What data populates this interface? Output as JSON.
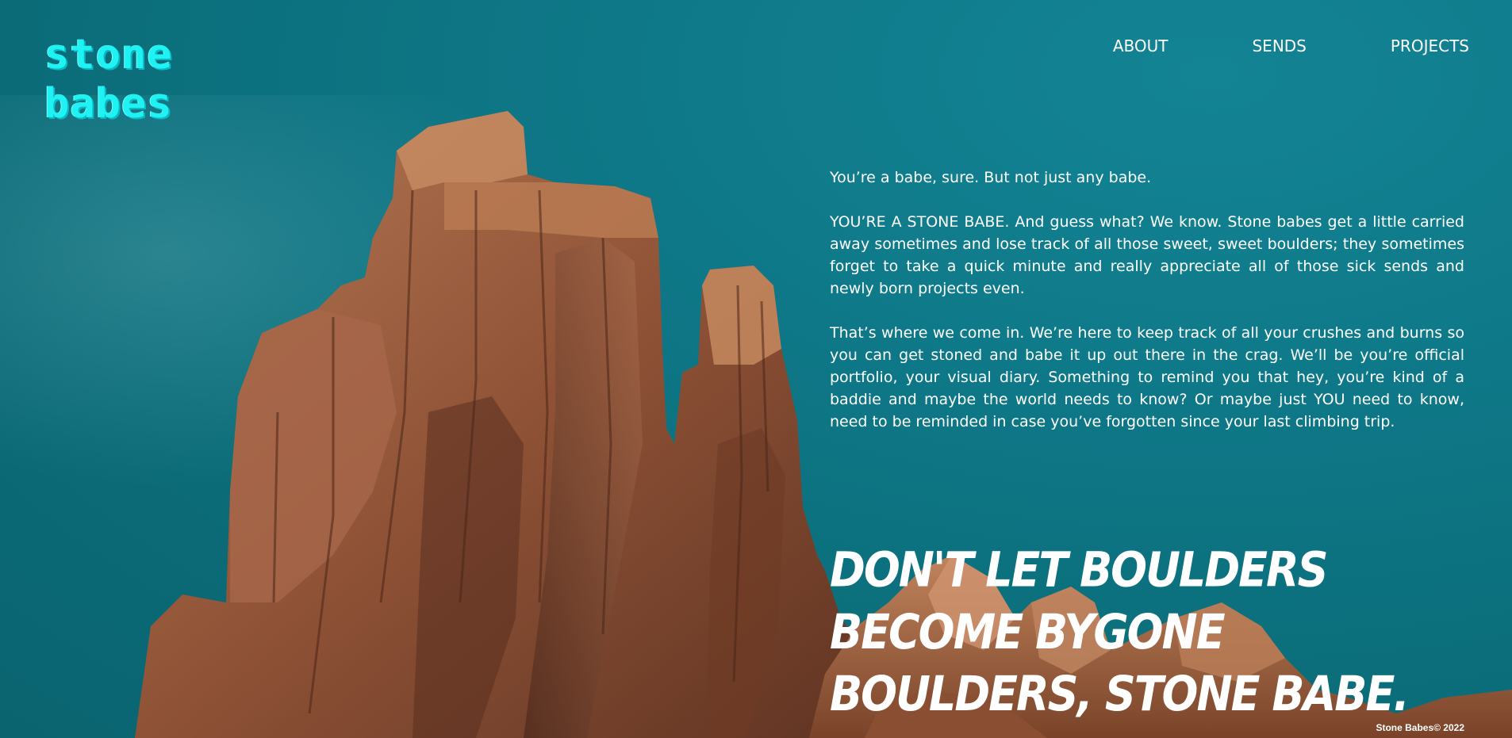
{
  "brand": {
    "line1": "stone",
    "line2": "babes"
  },
  "nav": {
    "items": [
      {
        "label": "ABOUT"
      },
      {
        "label": "SENDS"
      },
      {
        "label": "PROJECTS"
      }
    ]
  },
  "intro": {
    "p1": "You’re a babe, sure. But not just any babe.",
    "p2": "YOU’RE A STONE BABE. And guess what? We know. Stone babes get a little carried away sometimes and lose track of all those sweet, sweet boulders; they sometimes forget to take a quick minute and really appreciate all of those sick sends and newly born projects even.",
    "p3": "That’s where we come in. We’re here to keep track of all your crushes and burns so you can get stoned and babe it up out there in the crag. We’ll be you’re official portfolio, your visual diary. Something to remind you that hey, you’re kind of a baddie and maybe the world needs to know? Or maybe just YOU need to know, need to be reminded in case you’ve forgotten since your last climbing trip."
  },
  "headline": {
    "line1": "Don't let boulders become bygone",
    "line2": "boulders, stone babe."
  },
  "footer": {
    "text": "Stone Babes© 2022"
  },
  "colors": {
    "sky": "#0e7888",
    "logo": "#1ef2f2",
    "text": "#ffffff",
    "rock": "#9a5a3a"
  }
}
